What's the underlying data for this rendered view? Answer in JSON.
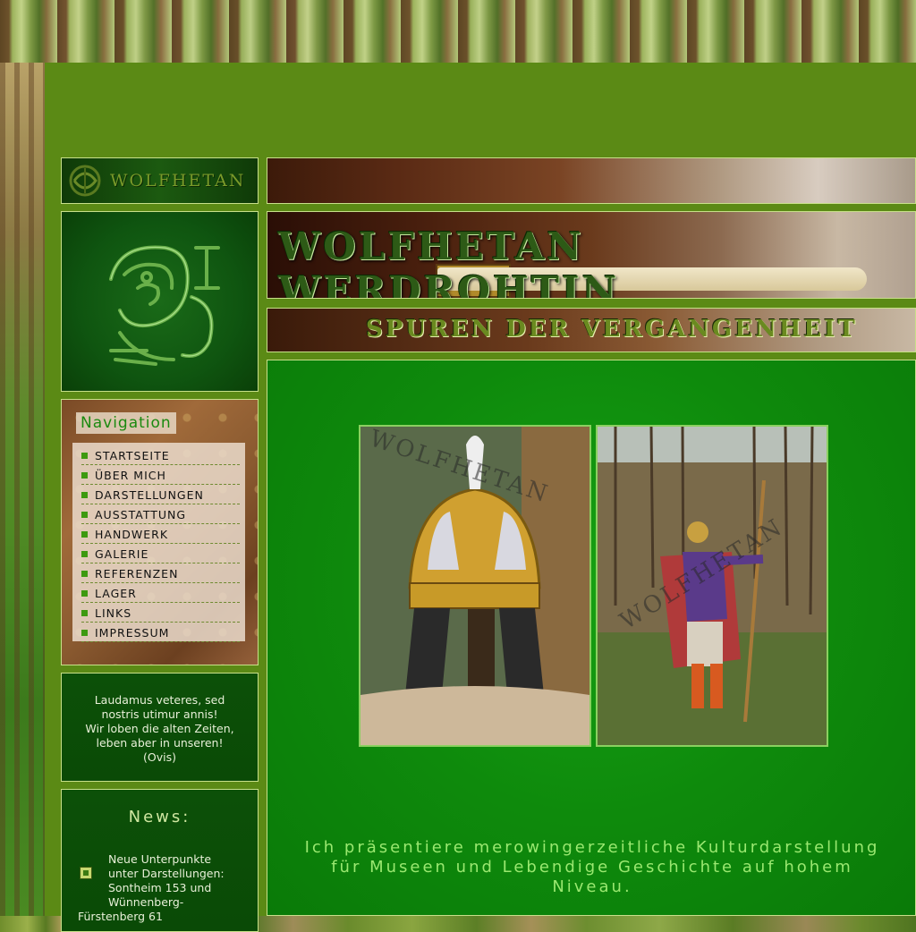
{
  "site": {
    "logo_small_text": "WOLFHETAN",
    "banner_title": "WOLFHETAN WERDROHTIN",
    "banner_subtitle": "SPUREN DER VERGANGENHEIT"
  },
  "navigation": {
    "title": "Navigation",
    "items": [
      {
        "label": "STARTSEITE"
      },
      {
        "label": "ÜBER MICH"
      },
      {
        "label": "DARSTELLUNGEN"
      },
      {
        "label": "AUSSTATTUNG"
      },
      {
        "label": "HANDWERK"
      },
      {
        "label": "GALERIE"
      },
      {
        "label": "REFERENZEN"
      },
      {
        "label": "LAGER"
      },
      {
        "label": "LINKS"
      },
      {
        "label": "IMPRESSUM"
      }
    ]
  },
  "quote": {
    "lines": [
      "Laudamus veteres, sed",
      "nostris utimur annis!",
      "Wir loben die alten Zeiten,",
      "leben aber in unseren!",
      "(Ovis)"
    ]
  },
  "news": {
    "title": "News:",
    "item_lines": [
      "Neue Unterpunkte",
      "unter Darstellungen:",
      "Sontheim 153 und",
      "Wünnenberg-",
      "Fürstenberg 61"
    ]
  },
  "content": {
    "watermark": "WOLFHETAN",
    "intro_lines": [
      "Ich präsentiere merowingerzeitliche Kulturdarstellung",
      "für Museen und Lebendige Geschichte auf hohem",
      "Niveau."
    ]
  },
  "colors": {
    "page_green": "#5b8a15",
    "content_green": "#0e8a0c",
    "accent_text": "#9ae870"
  },
  "icons": [
    "celtic-knot-logo-icon",
    "wolf-emblem-icon",
    "nav-bullet-icon",
    "news-item-icon"
  ]
}
